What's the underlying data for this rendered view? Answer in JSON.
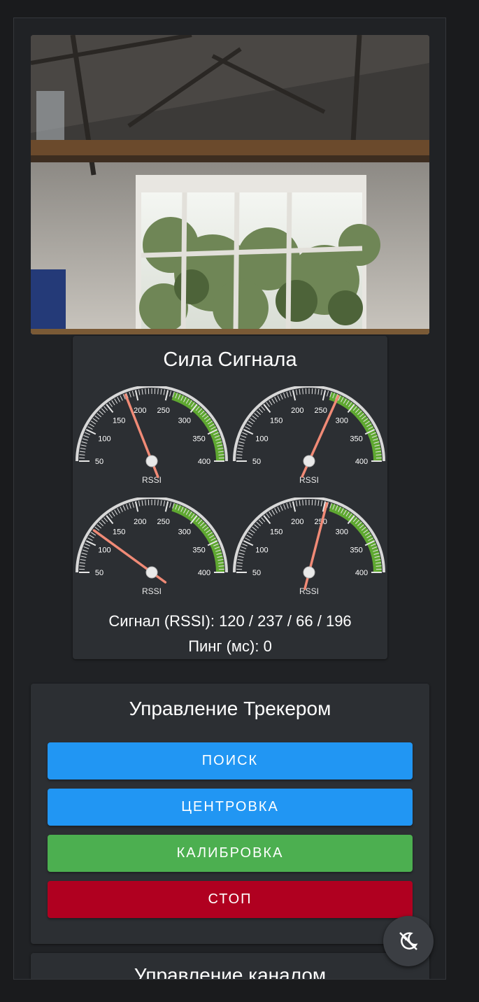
{
  "camera": {
    "alt": ""
  },
  "signal": {
    "title": "Сила Сигнала",
    "gauge_label": "RSSI",
    "ticks": [
      "50",
      "100",
      "150",
      "200",
      "250",
      "300",
      "350",
      "400"
    ],
    "scale_min": 50,
    "scale_max": 400,
    "green_from": 260,
    "values": [
      183,
      272,
      120,
      253
    ],
    "rssi_text": "Сигнал (RSSI): 120 / 237 / 66 / 196",
    "ping_text": "Пинг (мс): 0"
  },
  "tracker": {
    "title": "Управление Трекером",
    "buttons": [
      {
        "label": "ПОИСК",
        "color": "#2196f3"
      },
      {
        "label": "ЦЕНТРОВКА",
        "color": "#2196f3"
      },
      {
        "label": "КАЛИБРОВКА",
        "color": "#4caf50"
      },
      {
        "label": "СТОП",
        "color": "#b00020"
      }
    ]
  },
  "channel": {
    "title": "Управление каналом"
  },
  "theme_toggle": {
    "icon": "theme-toggle-icon"
  }
}
